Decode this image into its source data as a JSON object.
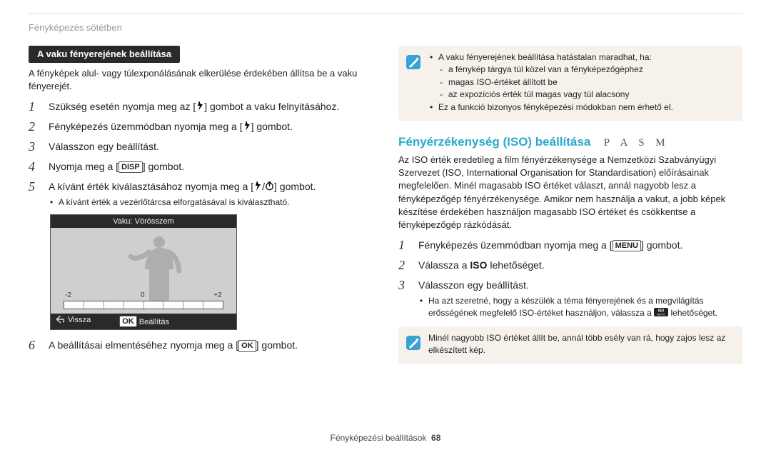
{
  "running_head": "Fényképezés sötétben",
  "left": {
    "subhead": "A vaku fényerejének beállítása",
    "intro": "A fényképek alul- vagy túlexponálásának elkerülése érdekében állítsa be a vaku fényerejét.",
    "steps": [
      {
        "pre": "Szükség esetén nyomja meg az [",
        "icon": "flash",
        "post": "] gombot a vaku felnyitásához."
      },
      {
        "pre": "Fényképezés üzemmódban nyomja meg a [",
        "icon": "flash",
        "post": "] gombot."
      },
      {
        "pre": "Válasszon egy beállítást.",
        "icon": null,
        "post": ""
      },
      {
        "pre": "Nyomja meg a [",
        "icon": "DISP",
        "post": "] gombot."
      },
      {
        "pre": "A kívánt érték kiválasztásához nyomja meg a [",
        "icon": "flash-timer",
        "post": "] gombot.",
        "sub": "A kívánt érték a vezérlőtárcsa elforgatásával is kiválasztható."
      },
      {
        "pre": "A beállításai elmentéséhez nyomja meg a [",
        "icon": "OK",
        "post": "] gombot."
      }
    ],
    "lcd": {
      "title": "Vaku: Vörösszem",
      "scale": [
        "-2",
        "0",
        "+2"
      ],
      "back_label": "Vissza",
      "set_label": "Beállítás"
    }
  },
  "right": {
    "note": {
      "lines": [
        "A vaku fényerejének beállítása hatástalan maradhat, ha:",
        "a fénykép tárgya túl közel van a fényképezőgéphez",
        "magas ISO-értéket állított be",
        "az expozíciós érték túl magas vagy túl alacsony",
        "Ez a funkció bizonyos fényképezési módokban nem érhető el."
      ]
    },
    "section_title": "Fényérzékenység (ISO) beállítása",
    "modes": "P A S M",
    "intro": "Az ISO érték eredetileg a film fényérzékenysége a Nemzetközi Szabványügyi Szervezet (ISO, International Organisation for Standardisation) előírásainak megfelelően. Minél magasabb ISO értéket választ, annál nagyobb lesz a fényképezőgép fényérzékenysége. Amikor nem használja a vakut, a jobb képek készítése érdekében használjon magasabb ISO értéket és csökkentse a fényképezőgép rázkódását.",
    "steps": [
      {
        "pre": "Fényképezés üzemmódban nyomja meg a [",
        "icon": "MENU",
        "post": "] gombot."
      },
      {
        "pre": "Válassza a ",
        "bold": "ISO",
        "post": " lehetőséget."
      },
      {
        "pre": "Válasszon egy beállítást.",
        "icon": null,
        "post": "",
        "sub": "Ha azt szeretné, hogy a készülék a téma fényerejének és a megvilágítás erősségének megfelelő ISO-értéket használjon, válassza a ",
        "sub_icon": "ISO-AUTO",
        "sub_post": " lehetőséget."
      }
    ],
    "note2": "Minél nagyobb ISO értéket állít be, annál több esély van rá, hogy zajos lesz az elkészített kép."
  },
  "footer": {
    "text": "Fényképezési beállítások",
    "page": "68"
  }
}
